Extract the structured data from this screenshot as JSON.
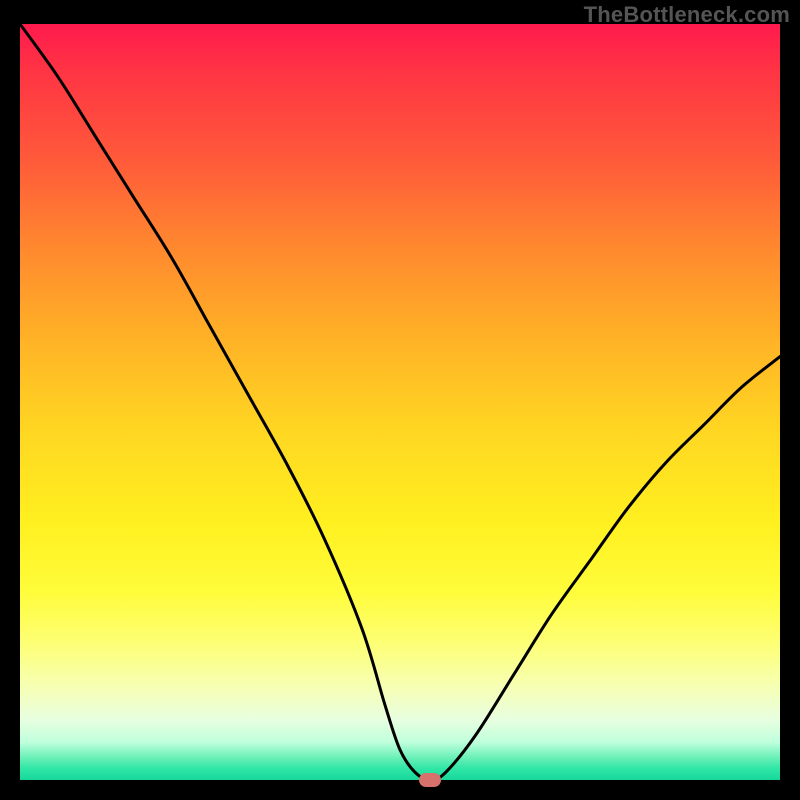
{
  "attribution": "TheBottleneck.com",
  "chart_data": {
    "type": "line",
    "title": "",
    "xlabel": "",
    "ylabel": "",
    "xlim": [
      0,
      100
    ],
    "ylim": [
      0,
      100
    ],
    "x": [
      0,
      5,
      10,
      15,
      20,
      25,
      30,
      35,
      40,
      45,
      48,
      50,
      52,
      54,
      56,
      60,
      65,
      70,
      75,
      80,
      85,
      90,
      95,
      100
    ],
    "values": [
      100,
      93,
      85,
      77,
      69,
      60,
      51,
      42,
      32,
      20,
      10,
      4,
      1,
      0,
      1,
      6,
      14,
      22,
      29,
      36,
      42,
      47,
      52,
      56
    ],
    "series": [
      {
        "name": "bottleneck-curve",
        "x_ref": "x",
        "y_ref": "values"
      }
    ],
    "marker": {
      "x": 54,
      "y": 0
    },
    "gradient_stops": [
      {
        "pos": 0,
        "color": "#ff1a4d"
      },
      {
        "pos": 50,
        "color": "#ffd722"
      },
      {
        "pos": 100,
        "color": "#16d89a"
      }
    ]
  }
}
